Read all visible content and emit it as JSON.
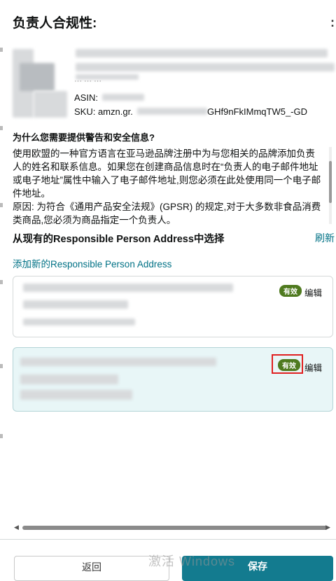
{
  "dialog": {
    "title": "负责人合规性:",
    "close_glyph": ":"
  },
  "product": {
    "asin_label": "ASIN:",
    "sku_prefix": "SKU: amzn.gr.",
    "sku_suffix": "GHf9nFkIMmqTW5_-GD",
    "partial_label": "··· ··· ···"
  },
  "info": {
    "question": "为什么您需要提供警告和安全信息?",
    "paragraph1": "使用欧盟的一种官方语言在亚马逊品牌注册中为与您相关的品牌添加负责人的姓名和联系信息。如果您在创建商品信息时在“负责人的电子邮件地址或电子地址”属性中输入了电子邮件地址,则您必须在此处使用同一个电子邮件地址。",
    "paragraph2": "原因: 为符合《通用产品安全法规》(GPSR) 的规定,对于大多数非食品消费类商品,您必须为商品指定一个负责人。"
  },
  "select_section": {
    "heading": "从现有的Responsible Person Address中选择",
    "refresh_label": "刷新",
    "add_link": "添加新的Responsible Person Address"
  },
  "addresses": [
    {
      "status": "有效",
      "edit_label": "编辑",
      "selected": false
    },
    {
      "status": "有效",
      "edit_label": "编辑",
      "selected": true
    }
  ],
  "footer": {
    "back_label": "返回",
    "save_label": "保存",
    "watermark": "激活 Windows"
  },
  "colors": {
    "link": "#007185",
    "badge": "#4f7a1f",
    "selected_card": "#e8f6f7",
    "highlight": "#e02020",
    "save_button": "#137b8f"
  }
}
